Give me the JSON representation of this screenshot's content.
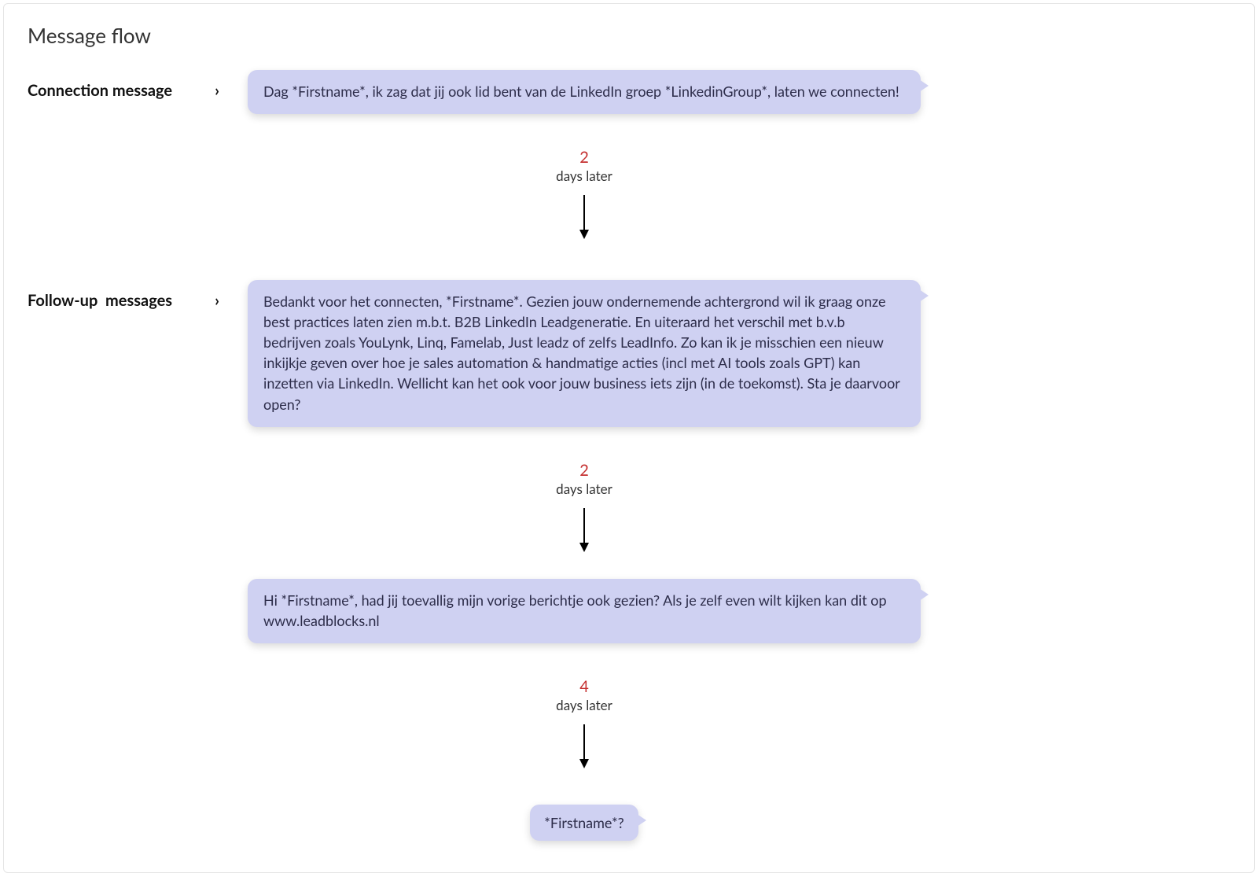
{
  "panel": {
    "title": "Message flow"
  },
  "stages": {
    "connection": {
      "label": "Connection message"
    },
    "followup": {
      "label": "Follow-up  messages"
    }
  },
  "messages": {
    "m1": "Dag *Firstname*, ik zag dat jij ook lid bent van de LinkedIn groep *LinkedinGroup*, laten we connecten!",
    "m2": "Bedankt voor het connecten, *Firstname*. Gezien jouw ondernemende achtergrond wil ik graag onze best practices laten zien m.b.t. B2B LinkedIn Leadgeneratie. En uiteraard het verschil met b.v.b bedrijven zoals YouLynk, Linq, Famelab, Just leadz of zelfs LeadInfo. Zo kan ik je misschien een nieuw inkijkje geven over hoe je sales automation & handmatige acties (incl met AI tools zoals GPT) kan inzetten via LinkedIn. Wellicht kan het ook voor jouw business iets zijn (in de toekomst). Sta je daarvoor open?",
    "m3": "Hi *Firstname*, had jij toevallig mijn vorige berichtje ook gezien? Als je zelf even wilt kijken kan dit op www.leadblocks.nl",
    "m4": "*Firstname*?"
  },
  "delays": {
    "d1": {
      "count": "2",
      "unit": "days later"
    },
    "d2": {
      "count": "2",
      "unit": "days later"
    },
    "d3": {
      "count": "4",
      "unit": "days later"
    }
  }
}
